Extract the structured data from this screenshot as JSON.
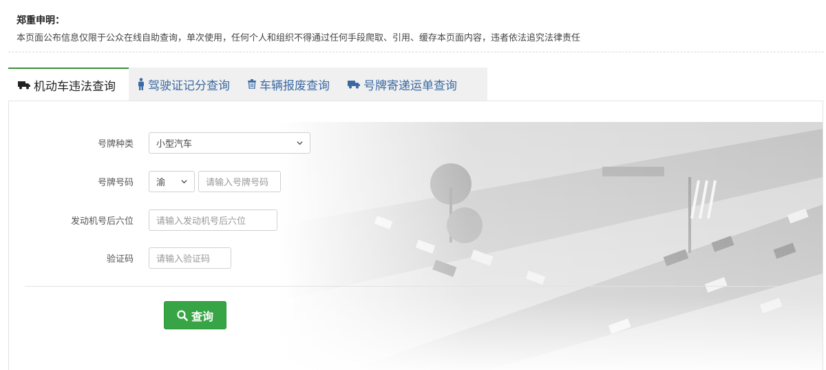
{
  "notice": {
    "title": "郑重申明：",
    "text": "本页面公布信息仅限于公众在线自助查询，单次使用，任何个人和组织不得通过任何手段爬取、引用、缓存本页面内容，违者依法追究法律责任"
  },
  "tabs": [
    {
      "label": "机动车违法查询",
      "icon": "truck-icon",
      "active": true
    },
    {
      "label": "驾驶证记分查询",
      "icon": "person-icon",
      "active": false
    },
    {
      "label": "车辆报废查询",
      "icon": "trash-icon",
      "active": false
    },
    {
      "label": "号牌寄递运单查询",
      "icon": "truck-icon",
      "active": false
    }
  ],
  "form": {
    "plate_type": {
      "label": "号牌种类",
      "value": "小型汽车"
    },
    "plate_number": {
      "label": "号牌号码",
      "prefix": "渝",
      "placeholder": "请输入号牌号码"
    },
    "engine": {
      "label": "发动机号后六位",
      "placeholder": "请输入发动机号后六位"
    },
    "captcha": {
      "label": "验证码",
      "placeholder": "请输入验证码"
    },
    "submit_label": "查询"
  },
  "colors": {
    "accent_green": "#37a545",
    "tab_blue": "#3b6aa3"
  }
}
